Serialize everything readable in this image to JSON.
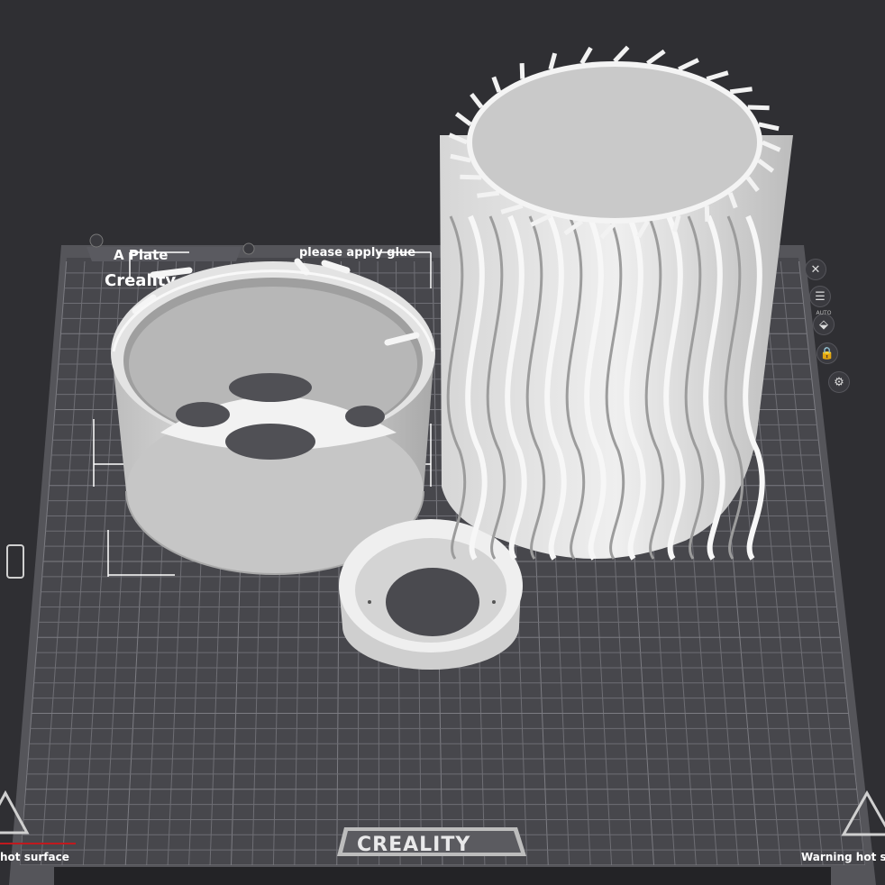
{
  "plate": {
    "tab_label": "A Plate",
    "bed_brand_label": "CREALITY",
    "printed_brand": "Creality",
    "glue_note": "please apply glue",
    "warning_left": "hot surface",
    "warning_right": "Warning hot s"
  },
  "toolbar": {
    "items": [
      {
        "name": "close-icon",
        "glyph": "✕"
      },
      {
        "name": "arrange-icon",
        "glyph": "☰"
      },
      {
        "name": "auto-orient-icon",
        "glyph": "⬙",
        "small_label": "AUTO"
      },
      {
        "name": "lock-icon",
        "glyph": "🔒"
      },
      {
        "name": "settings-icon",
        "glyph": "⚙"
      }
    ]
  },
  "colors": {
    "background": "#2f2f33",
    "bed": "#4a4a4f",
    "grid": "#6b6b70",
    "model": "#d9d9d9",
    "axis_x": "#c0191e"
  }
}
